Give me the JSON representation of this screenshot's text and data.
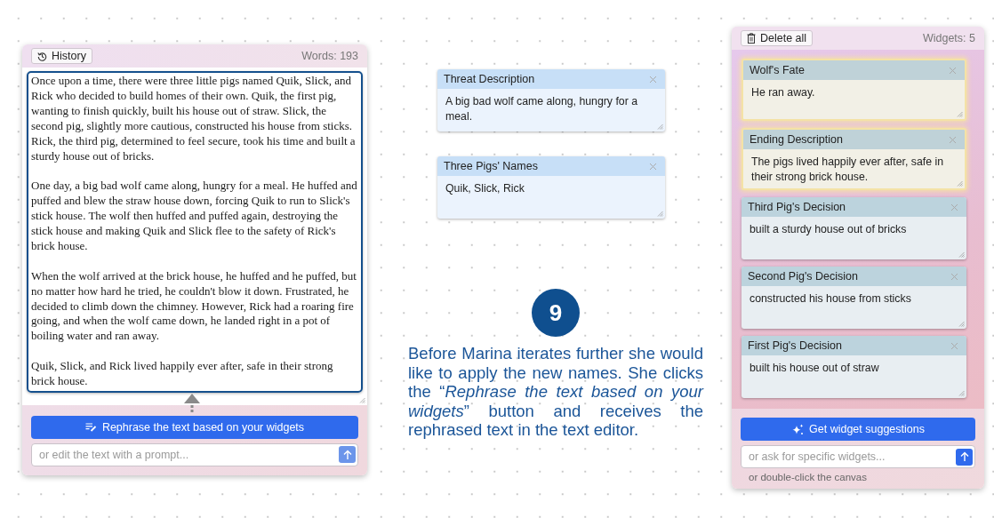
{
  "editor": {
    "history_button": "History",
    "word_count": "Words: 193",
    "focused": true,
    "paragraphs": [
      "Once upon a time, there were three little pigs named Quik, Slick, and Rick who decided to build homes of their own. Quik, the first pig, wanting to finish quickly, built his house out of straw. Slick, the second pig, slightly more cautious, constructed his house from sticks. Rick, the third pig, determined to feel secure, took his time and built a sturdy house out of bricks.",
      "One day, a big bad wolf came along, hungry for a meal. He huffed and puffed and blew the straw house down, forcing Quik to run to Slick's stick house. The wolf then huffed and puffed again, destroying the stick house and making Quik and Slick flee to the safety of Rick's brick house.",
      "When the wolf arrived at the brick house, he huffed and he puffed, but no matter how hard he tried, he couldn't blow it down. Frustrated, he decided to climb down the chimney. However, Rick had a roaring fire going, and when the wolf came down, he landed right in a pot of boiling water and ran away.",
      "Quik, Slick, and Rick lived happily ever after, safe in their strong brick house."
    ],
    "rephrase_button": "Rephrase the text based on your widgets",
    "prompt_placeholder": "or edit the text with a prompt..."
  },
  "canvas_widgets": [
    {
      "title": "Threat Description",
      "text": "A big bad wolf came along, hungry for a meal."
    },
    {
      "title": "Three Pigs' Names",
      "text": "Quik, Slick, Rick"
    }
  ],
  "annotation": {
    "step": "9",
    "text": "Before Marina iterates further she would like to apply the new names. She clicks the “*Rephrase the text based on your widgets*” button and receives the rephrased text in the text editor."
  },
  "widget_panel": {
    "delete_button": "Delete all",
    "count": "Widgets: 5",
    "widgets": [
      {
        "title": "Wolf's Fate",
        "text": "He ran away.",
        "highlighted": true
      },
      {
        "title": "Ending Description",
        "text": "The pigs lived happily ever after, safe in their strong brick house.",
        "highlighted": true
      },
      {
        "title": "Third Pig's Decision",
        "text": "built a sturdy house out of bricks",
        "highlighted": false
      },
      {
        "title": "Second Pig's Decision",
        "text": "constructed his house from sticks",
        "highlighted": false
      },
      {
        "title": "First Pig's Decision",
        "text": "built his house out of straw",
        "highlighted": false
      }
    ],
    "suggest_button": "Get widget suggestions",
    "ask_placeholder": "or ask for specific widgets...",
    "hint": "or double-click the canvas"
  }
}
